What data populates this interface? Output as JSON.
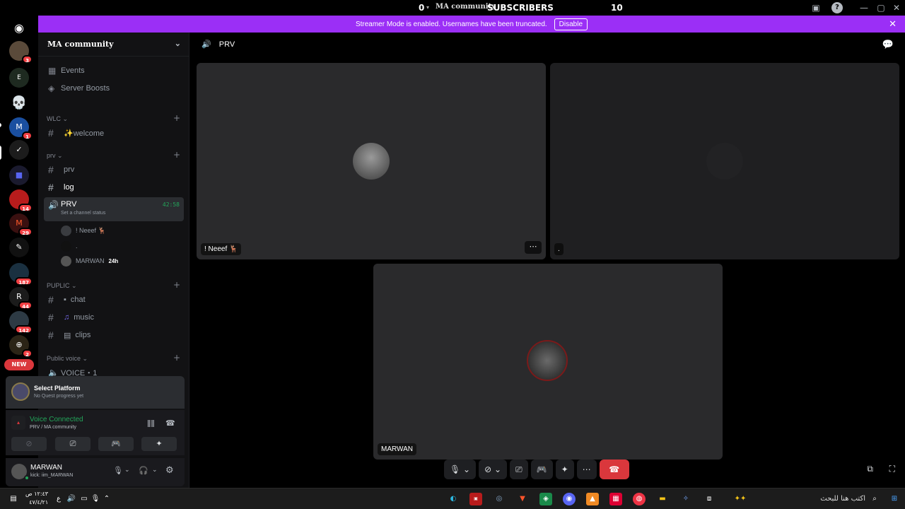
{
  "topbar": {
    "counter_left": "0",
    "community_small": "MA community",
    "subscribers_label": "SUBSCRIBERS",
    "subscribers_count": "10"
  },
  "banner": {
    "text": "Streamer Mode is enabled. Usernames have been truncated.",
    "disable_label": "Disable"
  },
  "rail": {
    "badges": [
      "3",
      "1",
      "14",
      "29",
      "187",
      "44",
      "142",
      "2"
    ],
    "new_label": "NEW"
  },
  "sidebar": {
    "server_name": "MA community",
    "top_items": [
      {
        "label": "Events"
      },
      {
        "label": "Server Boosts"
      }
    ],
    "categories": {
      "wlc": "WLC",
      "prv": "prv",
      "puplic": "PUPLIC",
      "public_voice": "Public voice"
    },
    "channels": {
      "welcome": "✨welcome",
      "prv": "prv",
      "log": "log",
      "chat": "chat",
      "music": "music",
      "clips": "clips",
      "voice1": "VOICE・1"
    },
    "active_voice": {
      "name": "PRV",
      "timer": "42:58",
      "status": "Set a channel status"
    },
    "voice_users": [
      {
        "name": "! Neeef 🦌"
      },
      {
        "name": "."
      },
      {
        "name": "MARWAN",
        "tag": "24h"
      }
    ]
  },
  "quest": {
    "title": "Select Platform",
    "sub": "No Quest progress yet"
  },
  "voice_panel": {
    "status": "Voice Connected",
    "channel": "PRV / MA community"
  },
  "user_panel": {
    "name": "MARWAN",
    "status": "kick: iim_MARWAN"
  },
  "main": {
    "channel_title": "PRV",
    "tiles": [
      {
        "name": "! Neeef 🦌"
      },
      {
        "name": "."
      },
      {
        "name": "MARWAN"
      }
    ]
  },
  "taskbar": {
    "time": "١٢:٤٣ ص",
    "date": "٤٧/٤/٢١",
    "lang": "ع",
    "search_placeholder": "اكتب هنا للبحث"
  },
  "colors": {
    "banner": "#9b2ff6",
    "online": "#23a55a",
    "hangup": "#da373c",
    "badge": "#f23f43"
  }
}
